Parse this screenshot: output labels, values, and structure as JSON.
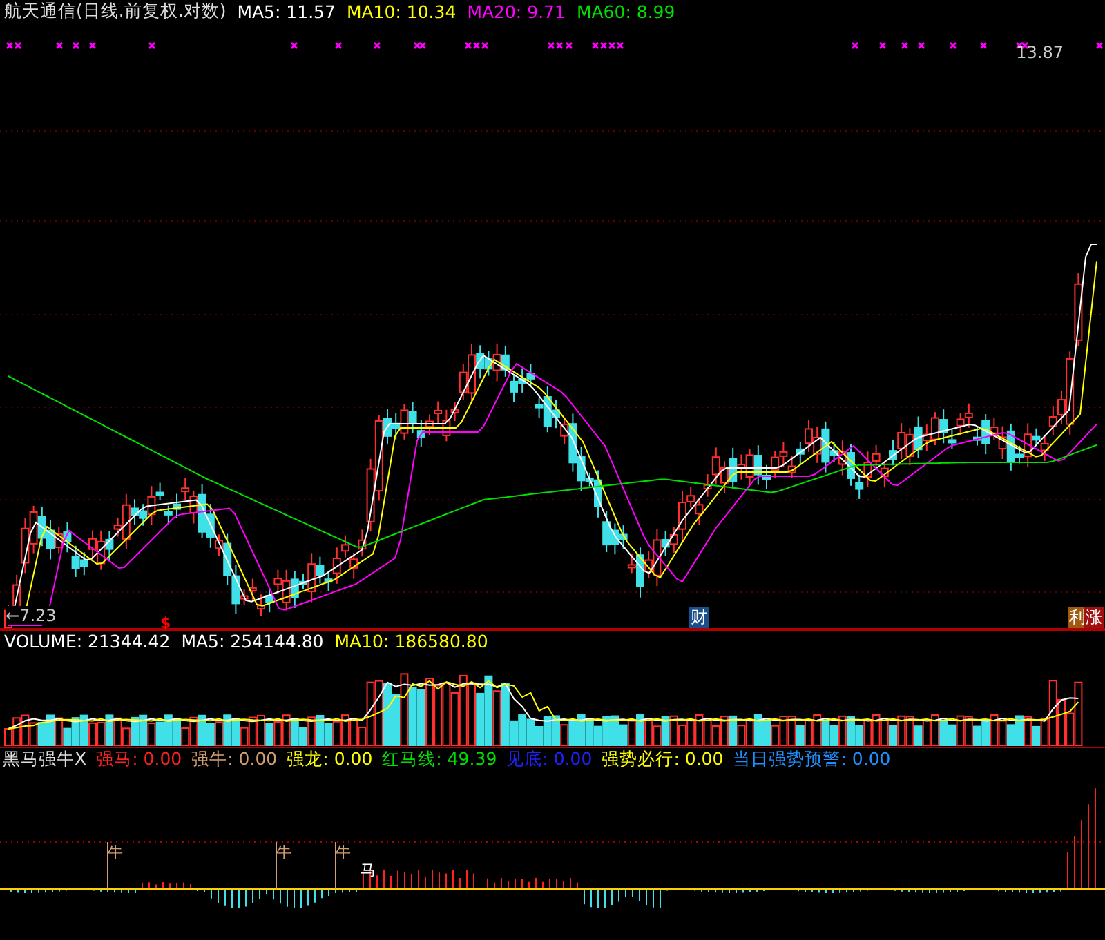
{
  "header": {
    "title": "航天通信(日线.前复权.对数)",
    "indicators": [
      {
        "label": "MA5: 11.57",
        "color": "#ffffff"
      },
      {
        "label": "MA10: 10.34",
        "color": "#ffff00"
      },
      {
        "label": "MA20: 9.71",
        "color": "#ff00ff"
      },
      {
        "label": "MA60: 8.99",
        "color": "#00e000"
      }
    ]
  },
  "price_chart": {
    "high_label": "13.87",
    "low_label": "←7.23",
    "dividend_mark": "$",
    "badges": [
      {
        "text": "财",
        "color": "#1a4f8a"
      },
      {
        "text": "利",
        "color": "#a05a10"
      },
      {
        "text": "涨",
        "color": "#a01010"
      }
    ]
  },
  "volume_bar": {
    "indicators": [
      {
        "label": "VOLUME: 21344.42",
        "color": "#ffffff"
      },
      {
        "label": "MA5: 254144.80",
        "color": "#ffffff"
      },
      {
        "label": "MA10: 186580.80",
        "color": "#ffff00"
      }
    ]
  },
  "indicator_bar": {
    "name": "黑马强牛X",
    "indicators": [
      {
        "label": "强马: 0.00",
        "color": "#ff2020"
      },
      {
        "label": "强牛: 0.00",
        "color": "#d2a070"
      },
      {
        "label": "强龙: 0.00",
        "color": "#ffff00"
      },
      {
        "label": "红马线: 49.39",
        "color": "#00e000"
      },
      {
        "label": "见底: 0.00",
        "color": "#2020ff"
      },
      {
        "label": "强势必行: 0.00",
        "color": "#ffff00"
      },
      {
        "label": "当日强势预警: 0.00",
        "color": "#1e90ff"
      }
    ],
    "signals": [
      {
        "text": "牛",
        "kind": "bull"
      },
      {
        "text": "牛",
        "kind": "bull"
      },
      {
        "text": "牛",
        "kind": "bull"
      },
      {
        "text": "马",
        "kind": "horse"
      }
    ]
  }
}
